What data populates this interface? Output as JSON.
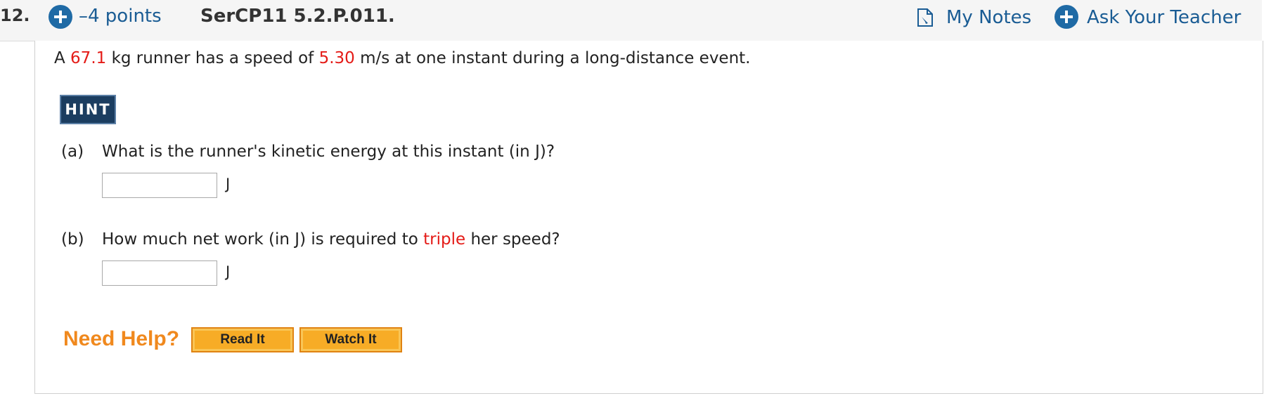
{
  "header": {
    "question_number": "12.",
    "points": "–4 points",
    "question_id": "SerCP11 5.2.P.011.",
    "my_notes": "My Notes",
    "ask_teacher": "Ask Your Teacher"
  },
  "problem": {
    "prefix": "A ",
    "mass": "67.1",
    "mid": " kg runner has a speed of ",
    "speed": "5.30",
    "suffix": " m/s at one instant during a long-distance event."
  },
  "hint_label": "HINT",
  "parts": [
    {
      "label": "(a)",
      "question": "What is the runner's kinetic energy at this instant (in J)?",
      "value": "",
      "unit": "J"
    },
    {
      "label": "(b)",
      "question_before": "How much net work (in J) is required to ",
      "question_highlight": "triple",
      "question_after": " her speed?",
      "value": "",
      "unit": "J"
    }
  ],
  "help": {
    "title": "Need Help?",
    "read_it": "Read It",
    "watch_it": "Watch It"
  },
  "colors": {
    "accent_blue": "#1f6aa5",
    "highlight_red": "#e41b17",
    "help_orange": "#f0891e",
    "button_orange": "#f7ac26"
  },
  "icons": {
    "points": "plus-circle-icon",
    "notes": "note-icon",
    "ask": "plus-circle-icon"
  }
}
